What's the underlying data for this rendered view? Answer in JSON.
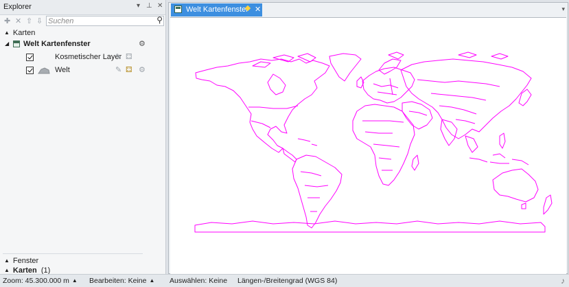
{
  "explorer": {
    "title": "Explorer",
    "controls": {
      "dropdown": "▾",
      "pin": "⊥",
      "close": "✕"
    },
    "toolbar": {
      "icons": [
        "add-icon",
        "remove-icon",
        "move-up-icon",
        "move-down-icon"
      ],
      "search_placeholder": "Suchen"
    },
    "section_title": "Karten",
    "map": {
      "name": "Welt Kartenfenster"
    },
    "layers": [
      {
        "name": "Kosmetischer Layer",
        "checked": true
      },
      {
        "name": "Welt",
        "checked": true
      }
    ],
    "footer": {
      "section": "Fenster",
      "item_label": "Karten",
      "item_count": "(1)"
    }
  },
  "document": {
    "tab_title": "Welt Kartenfenster",
    "close_glyph": "✕",
    "menu_glyph": "▾"
  },
  "map_style": {
    "stroke": "#ff00ff",
    "background": "#ffffff"
  },
  "statusbar": {
    "zoom": "Zoom: 45.300.000 m",
    "edit": "Bearbeiten: Keine",
    "select": "Auswählen: Keine",
    "projection": "Längen-/Breitengrad (WGS 84)"
  },
  "colors": {
    "accent": "#3d8fe0",
    "pin": "#ffd23f",
    "map_line": "#ff00ff"
  }
}
